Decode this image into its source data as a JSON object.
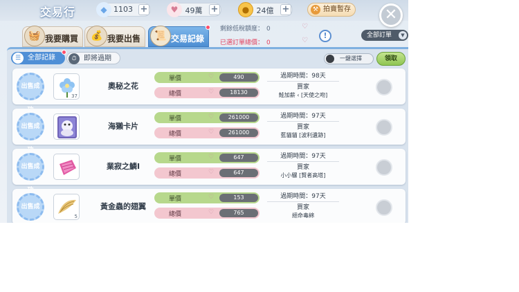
{
  "header": {
    "title": "交易行",
    "diamond": "1103",
    "heart": "49萬",
    "coin": "24億",
    "auction_label": "拍賣暫存"
  },
  "tabs": [
    {
      "label": "我要購買",
      "active": false
    },
    {
      "label": "我要出售",
      "active": false
    },
    {
      "label": "交易記錄",
      "active": true
    }
  ],
  "info": {
    "remaining_label": "剩餘低稅額度：",
    "remaining_value": "0",
    "selected_label": "已選訂單總價：",
    "selected_value": "0"
  },
  "filter": {
    "label": "全部訂單"
  },
  "subtabs": {
    "all": "全部記錄",
    "expiring": "即將過期"
  },
  "toggle": {
    "label": "一鍵選擇"
  },
  "claim": {
    "label": "領取"
  },
  "labels": {
    "stamp": "出售成功",
    "unit_price": "單價",
    "total_price": "總價",
    "buyer": "買家"
  },
  "records": [
    {
      "name": "奧秘之花",
      "qty": "37",
      "unit": "490",
      "total": "18130",
      "expiry": "過期時間：98天",
      "buyer": "鮭加薪 ‹ [天使之吻]",
      "icon": "flower-icon"
    },
    {
      "name": "海獺卡片",
      "qty": "",
      "unit": "261000",
      "total": "261000",
      "expiry": "過期時間：97天",
      "buyer": "藍貓貓 [波利遺跡]",
      "icon": "card-icon"
    },
    {
      "name": "業寂之鱗Ⅰ",
      "qty": "",
      "unit": "647",
      "total": "647",
      "expiry": "過期時間：97天",
      "buyer": "小小騾 [賢者高塔]",
      "icon": "scale-icon"
    },
    {
      "name": "黃金蟲的翅翼",
      "qty": "5",
      "unit": "153",
      "total": "765",
      "expiry": "過期時間：97天",
      "buyer": "絕命毒綿",
      "icon": "wing-icon"
    }
  ],
  "colors": {
    "accent_blue": "#4f8fd6",
    "unit_bar": "#b7d88c",
    "total_bar": "#f3c7cf",
    "claim_green": "#8fc552"
  }
}
